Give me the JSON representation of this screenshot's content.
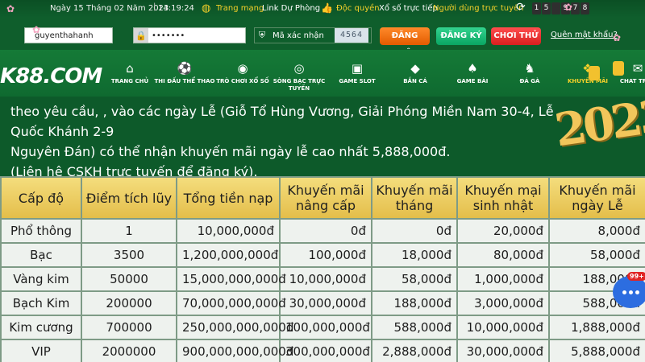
{
  "topbar": {
    "date": "Ngày 15 Tháng 02 Năm 2023",
    "sep": "|",
    "time": "14:19:24",
    "network": "Trang mạng",
    "backup": "Link Dự Phòng",
    "exclusive": "Độc quyền",
    "lottery": "Xổ số trực tiếp",
    "online_label": "Người dùng trực tuyến",
    "online_digits": [
      "1",
      "5",
      "",
      "9",
      "7",
      "8"
    ]
  },
  "login": {
    "username": "guyenthahanh",
    "password_mask": "•••••••",
    "captcha_label": "Mã xác nhận",
    "captcha_code": "4564",
    "login_btn": "ĐĂNG NHẬP",
    "register_btn": "ĐĂNG KÝ",
    "trial_btn": "CHƠI THỬ",
    "forgot": "Quên mật khẩu?"
  },
  "nav": {
    "logo": "K88.COM",
    "items": [
      {
        "label": "TRANG CHỦ",
        "icon": "home-icon"
      },
      {
        "label": "THI ĐẤU THỂ THAO",
        "icon": "soccer-ball-icon"
      },
      {
        "label": "TRÒ CHƠI XỔ SỐ",
        "icon": "lottery-ball-icon"
      },
      {
        "label": "SÒNG BẠC TRỰC TUYẾN",
        "icon": "casino-chip-icon"
      },
      {
        "label": "GAME SLOT",
        "icon": "slot-machine-icon"
      },
      {
        "label": "BẮN CÁ",
        "icon": "fish-icon"
      },
      {
        "label": "GAME BÀI",
        "icon": "cards-icon"
      },
      {
        "label": "ĐÁ GÀ",
        "icon": "rooster-icon"
      },
      {
        "label": "KHUYẾN MÃI",
        "icon": "gift-icon"
      },
      {
        "label": "CHAT TRỰC",
        "icon": "chat-icon"
      }
    ]
  },
  "intro": {
    "line1": "theo yêu cầu, , vào các ngày Lễ (Giỗ Tổ Hùng Vương, Giải Phóng Miền Nam 30-4, Lễ Quốc Khánh 2-9",
    "line2": "Nguyên Đán) có thể nhận khuyến mãi ngày lễ cao nhất 5,888,000đ.",
    "line3": "(Liên hệ CSKH trực tuyến để đăng ký).",
    "year": "2023"
  },
  "table": {
    "headers": [
      "Cấp độ",
      "Điểm tích lũy",
      "Tổng tiền nạp",
      "Khuyến mãi nâng cấp",
      "Khuyến mãi tháng",
      "Khuyến mại sinh nhật",
      "Khuyến mãi ngày Lễ"
    ],
    "rows": [
      [
        "Phổ thông",
        "1",
        "10,000,000đ",
        "0đ",
        "0đ",
        "20,000đ",
        "8,000đ"
      ],
      [
        "Bạc",
        "3500",
        "1,200,000,000đ",
        "100,000đ",
        "18,000đ",
        "80,000đ",
        "58,000đ"
      ],
      [
        "Vàng kim",
        "50000",
        "15,000,000,000đ",
        "10,000,000đ",
        "58,000đ",
        "1,000,000đ",
        "188,000đ"
      ],
      [
        "Bạch Kim",
        "200000",
        "70,000,000,000đ",
        "30,000,000đ",
        "188,000đ",
        "3,000,000đ",
        "588,000đ"
      ],
      [
        "Kim cương",
        "700000",
        "250,000,000,000đ",
        "100,000,000đ",
        "588,000đ",
        "10,000,000đ",
        "1,888,000đ"
      ],
      [
        "VIP",
        "2000000",
        "900,000,000,000đ",
        "300,000,000đ",
        "2,888,000đ",
        "30,000,000đ",
        "5,888,000đ"
      ]
    ]
  },
  "chat": {
    "badge": "99+"
  },
  "colors": {
    "accent": "#f5d02a",
    "header_gold": "#e4be4a",
    "bg_green": "#0d5a2a"
  }
}
